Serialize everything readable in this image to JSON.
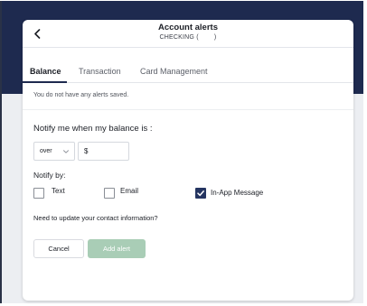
{
  "header": {
    "title": "Account alerts",
    "subtitle": "CHECKING (        )"
  },
  "tabs": [
    {
      "label": "Balance",
      "active": true
    },
    {
      "label": "Transaction",
      "active": false
    },
    {
      "label": "Card Management",
      "active": false
    }
  ],
  "balance": {
    "empty_message": "You do not have any alerts saved.",
    "notify_label": "Notify me when my balance is :",
    "condition_value": "over",
    "currency_symbol": "$",
    "amount_value": ""
  },
  "notify_by": {
    "label": "Notify by:",
    "options": [
      {
        "label": "Text",
        "checked": false
      },
      {
        "label": "Email",
        "checked": false
      },
      {
        "label": "In-App Message",
        "checked": true
      }
    ]
  },
  "contact_link": "Need to update your contact information?",
  "actions": {
    "cancel_label": "Cancel",
    "add_label": "Add alert"
  },
  "colors": {
    "navy": "#1e2a4f",
    "checkbox_checked": "#253561",
    "add_button_disabled": "#a9cdb6"
  },
  "icons": {
    "back": "chevron-left-icon",
    "dropdown": "chevron-down-icon",
    "check": "check-icon"
  }
}
